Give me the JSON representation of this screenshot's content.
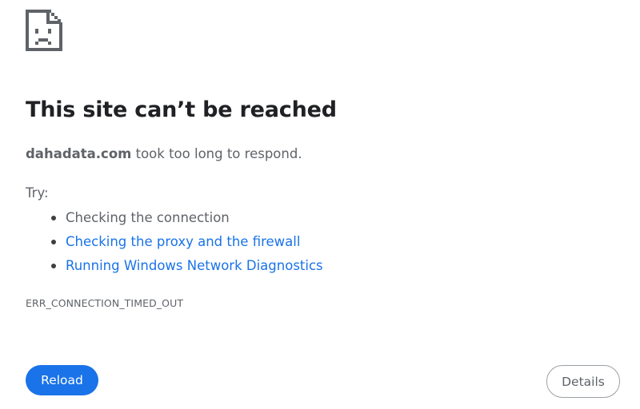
{
  "icon": "sad-page-icon",
  "title": "This site can’t be reached",
  "summary": {
    "host": "dahadata.com",
    "message": " took too long to respond."
  },
  "try_label": "Try:",
  "suggestions": [
    {
      "label": "Checking the connection",
      "is_link": false
    },
    {
      "label": "Checking the proxy and the firewall",
      "is_link": true
    },
    {
      "label": "Running Windows Network Diagnostics",
      "is_link": true
    }
  ],
  "error_code": "ERR_CONNECTION_TIMED_OUT",
  "buttons": {
    "reload": "Reload",
    "details": "Details"
  },
  "colors": {
    "link": "#1a73e8",
    "primary_button": "#1a73e8",
    "body_text": "#5f6368",
    "title_text": "#202124"
  }
}
